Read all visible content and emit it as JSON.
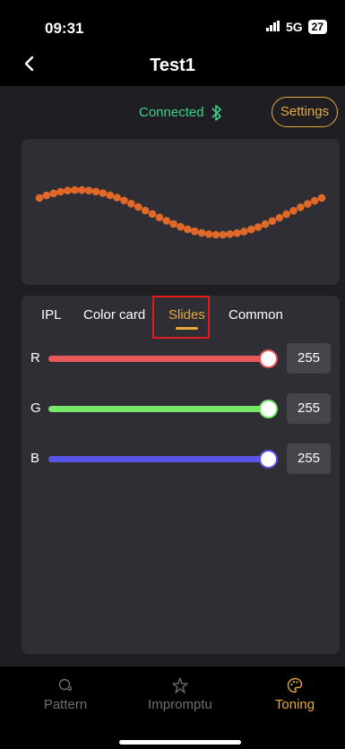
{
  "status_bar": {
    "time": "09:31",
    "network": "5G",
    "battery": "27"
  },
  "nav": {
    "title": "Test1",
    "back_icon": "chevron-left-icon"
  },
  "connection": {
    "status": "Connected",
    "icon": "bluetooth-icon",
    "settings_label": "Settings"
  },
  "preview": {
    "dot_color": "#e0692a",
    "dot_count": 41
  },
  "tabs": [
    {
      "label": "IPL",
      "active": false
    },
    {
      "label": "Color card",
      "active": false
    },
    {
      "label": "Slides",
      "active": true
    },
    {
      "label": "Common",
      "active": false
    }
  ],
  "sliders": [
    {
      "label": "R",
      "value": "255",
      "color": "#e85a5a",
      "level": 1.0
    },
    {
      "label": "G",
      "value": "255",
      "color": "#77e86a",
      "level": 1.0
    },
    {
      "label": "B",
      "value": "255",
      "color": "#5a55e8",
      "level": 1.0
    }
  ],
  "bottom_nav": [
    {
      "label": "Pattern",
      "icon": "pattern-icon",
      "active": false
    },
    {
      "label": "Impromptu",
      "icon": "impromptu-icon",
      "active": false
    },
    {
      "label": "Toning",
      "icon": "palette-icon",
      "active": true
    }
  ],
  "colors": {
    "accent": "#e6a93a",
    "connected": "#3ecf8e",
    "highlight_box": "#e01b1b"
  }
}
